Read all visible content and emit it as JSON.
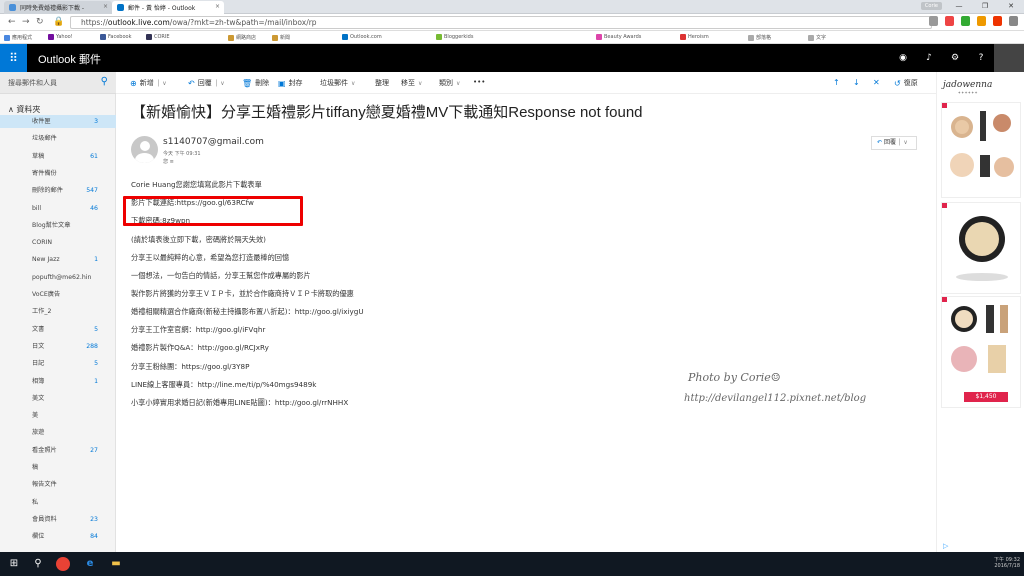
{
  "browser": {
    "tabs": [
      {
        "title": "同時免費婚禮攝影下載 -",
        "close": "×"
      },
      {
        "title": "郵件 - 黃 怡婷 - Outlook",
        "close": "×"
      }
    ],
    "user_chip": "Corie",
    "window_controls": [
      "—",
      "❐",
      "✕"
    ],
    "url_prefix": "https://",
    "url_host": "outlook.live.com",
    "url_path": "/owa/?mkt=zh-tw&path=/mail/inbox/rp",
    "bookmarks": [
      "應用程式",
      "Yahoo!",
      "Facebook",
      "CORIE",
      "網路商店",
      "新聞",
      "Outlook.com",
      "Bloggerkids",
      "Beauty Awards",
      "Heroism",
      "部落格",
      "文字"
    ]
  },
  "suite": {
    "brand": "Outlook 郵件",
    "waffle": "⠿"
  },
  "search": {
    "placeholder": "搜尋郵件和人員"
  },
  "folders": {
    "header": "資料夾",
    "items": [
      {
        "name": "收件匣",
        "count": "3",
        "selected": true
      },
      {
        "name": "垃圾郵件",
        "count": ""
      },
      {
        "name": "草稿",
        "count": "61"
      },
      {
        "name": "寄件備份",
        "count": ""
      },
      {
        "name": "刪除的郵件",
        "count": "547"
      },
      {
        "name": "bill",
        "count": "46"
      },
      {
        "name": "Blog幫忙文章",
        "count": ""
      },
      {
        "name": "CORIN",
        "count": ""
      },
      {
        "name": "New Jazz",
        "count": "1"
      },
      {
        "name": "popufth@me62.hin",
        "count": ""
      },
      {
        "name": "VoCE廣告",
        "count": ""
      },
      {
        "name": "工作_2",
        "count": ""
      },
      {
        "name": "文書",
        "count": "5"
      },
      {
        "name": "日文",
        "count": "288"
      },
      {
        "name": "日記",
        "count": "5"
      },
      {
        "name": "相簿",
        "count": "1"
      },
      {
        "name": "美文",
        "count": ""
      },
      {
        "name": "美",
        "count": ""
      },
      {
        "name": "旅遊",
        "count": ""
      },
      {
        "name": "看金照片",
        "count": "27"
      },
      {
        "name": "稿",
        "count": ""
      },
      {
        "name": "報告文件",
        "count": ""
      },
      {
        "name": "私",
        "count": ""
      },
      {
        "name": "會員資料",
        "count": "23"
      },
      {
        "name": "欄位",
        "count": "84"
      }
    ]
  },
  "commands": {
    "new": "新增",
    "reply": "回覆",
    "delete": "刪除",
    "archive": "封存",
    "junk": "垃圾郵件",
    "sweep": "整理",
    "move": "移至",
    "categories": "類別",
    "more": "•••",
    "undo": "復原"
  },
  "message": {
    "subject": "【新婚愉快】分享王婚禮影片tiffany戀夏婚禮MV下載通知Response not found",
    "sender": "s1140707@gmail.com",
    "time": "今天 下午 09:31",
    "to": "您 ≡",
    "reply_label": "回覆",
    "body": [
      "Corie Huang您謝您填寫此影片下載表單",
      "影片下載連結:https://goo.gl/63RCfw",
      "下載密碼:8z9wpn",
      "(請於填表後立即下載，密碼將於隔天失效)",
      "分享王以最純粹的心意，希望為您打造最棒的回憶",
      "一個想法，一句告白的情話，分享王幫您作成專屬的影片",
      "製作影片將獲的分享王ＶＩＰ卡，並於合作廠商持ＶＩＰ卡將取的優惠",
      "婚禮相關精選合作廠商(新秘主持攝影布置八折起)：http://goo.gl/ixiygU",
      "分享王工作室官網：http://goo.gl/iFVqhr",
      "婚禮影片製作Q&A：http://goo.gl/RCJxRy",
      "分享王粉絲團：https://goo.gl/3Y8P",
      "LINE線上客服專員：http://line.me/ti/p/%40mgs9489k",
      "小享小婷實用求婚日記(新婚專用LINE貼圖)：http://goo.gl/rrNHHX"
    ]
  },
  "watermark": {
    "line1": "Photo by Corie☺",
    "line2": "http://devilangel112.pixnet.net/blog"
  },
  "ad": {
    "brand": "jadowenna",
    "price": "$1,450"
  },
  "taskbar": {
    "clock_time": "下午 09:32",
    "clock_date": "2016/7/18"
  }
}
